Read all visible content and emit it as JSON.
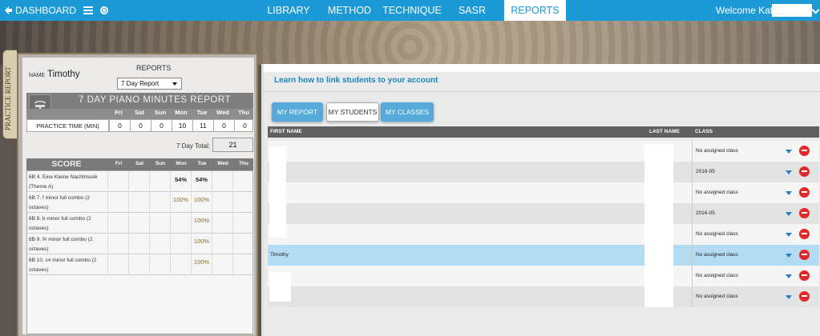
{
  "topbar": {
    "dashboard_label": "DASHBOARD",
    "nav": [
      "LIBRARY",
      "METHOD",
      "TECHNIQUE",
      "SASR",
      "REPORTS"
    ],
    "active_nav": "REPORTS",
    "welcome": "Welcome Kate"
  },
  "side_tab": {
    "label": "PRACTICE REPORT"
  },
  "report": {
    "name_label": "NAME",
    "student_name": "Timothy",
    "reports_label": "REPORTS",
    "report_select": "7 Day Report",
    "minutes_title": "7 DAY PIANO MINUTES REPORT",
    "days": [
      "Fri",
      "Sat",
      "Sun",
      "Mon",
      "Tue",
      "Wed",
      "Thu"
    ],
    "practice_label": "PRACTICE TIME (MIN)",
    "practice_values": [
      "0",
      "0",
      "0",
      "10",
      "11",
      "0",
      "0"
    ],
    "total_label": "7 Day Total:",
    "total_value": "21",
    "score_title": "SCORE",
    "scores": [
      {
        "name": "6B 4. Eine Kleine Nachtmusik (Theme A)",
        "mon": "54%",
        "tue": "54%"
      },
      {
        "name": "6B 7. f minor full combo (2 octaves)",
        "mon": "100%",
        "tue": "100%"
      },
      {
        "name": "6B 8. b minor full combo (2 octaves)",
        "mon": "",
        "tue": "100%"
      },
      {
        "name": "6B 9. f# minor full combo (2 octaves)",
        "mon": "",
        "tue": "100%"
      },
      {
        "name": "6B 10. c# minor full combo (2 octaves)",
        "mon": "",
        "tue": "100%"
      }
    ]
  },
  "right": {
    "link_text": "Learn how to link students to your account",
    "tabs": [
      "MY REPORT",
      "MY STUDENTS",
      "MY CLASSES"
    ],
    "columns": [
      "FIRST NAME",
      "LAST NAME",
      "CLASS"
    ],
    "rows": [
      {
        "first": "",
        "class": "No assigned class"
      },
      {
        "first": "",
        "class": "2016-05"
      },
      {
        "first": "",
        "class": "No assigned class"
      },
      {
        "first": "",
        "class": "2016-05"
      },
      {
        "first": "",
        "class": "No assigned class"
      },
      {
        "first": "Timothy",
        "class": "No assigned class"
      },
      {
        "first": "",
        "class": "No assigned class"
      },
      {
        "first": "",
        "class": "No assigned class"
      }
    ]
  }
}
